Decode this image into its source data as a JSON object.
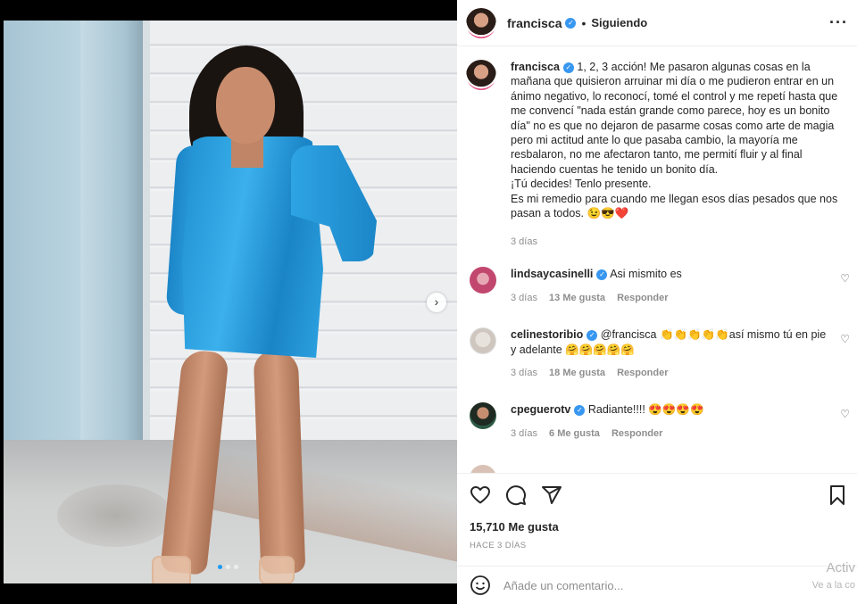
{
  "post": {
    "username": "francisca",
    "follow_status": "Siguiendo",
    "more_icon": "ellipsis-icon"
  },
  "caption": {
    "username": "francisca",
    "text": "1, 2, 3 acción! Me pasaron algunas cosas en la mañana que quisieron arruinar mi día o me pudieron entrar en un ánimo negativo, lo reconocí, tomé el control y me repetí hasta que me convencí \"nada están grande como parece, hoy es un bonito día\" no es que no dejaron de pasarme cosas como arte de magia pero mi actitud ante lo que pasaba cambio, la mayoría me resbalaron, no me afectaron tanto, me permití fluir y al final haciendo cuentas he tenido un bonito día.\n¡Tú decides! Tenlo presente.\nEs mi remedio para cuando me llegan esos días pesados que nos pasan a todos. 😉😎❤️",
    "time": "3 días"
  },
  "comments": [
    {
      "username": "lindsaycasinelli",
      "text": "Asi mismito es",
      "time": "3 días",
      "likes": "13 Me gusta",
      "reply": "Responder"
    },
    {
      "username": "celinestoribio",
      "text": "@francisca 👏👏👏👏👏así mismo tú en pie y adelante 🤗🤗🤗🤗🤗",
      "time": "3 días",
      "likes": "18 Me gusta",
      "reply": "Responder"
    },
    {
      "username": "cpeguerotv",
      "text": "Radiante!!!! 😍😍😍😍",
      "time": "3 días",
      "likes": "6 Me gusta",
      "reply": "Responder"
    }
  ],
  "actions": {
    "likes": "15,710 Me gusta",
    "time_ago": "HACE 3 DÍAS"
  },
  "add_comment": {
    "placeholder": "Añade un comentario..."
  },
  "watermark": {
    "line1": "Activ",
    "line2": "Ve a la co"
  }
}
